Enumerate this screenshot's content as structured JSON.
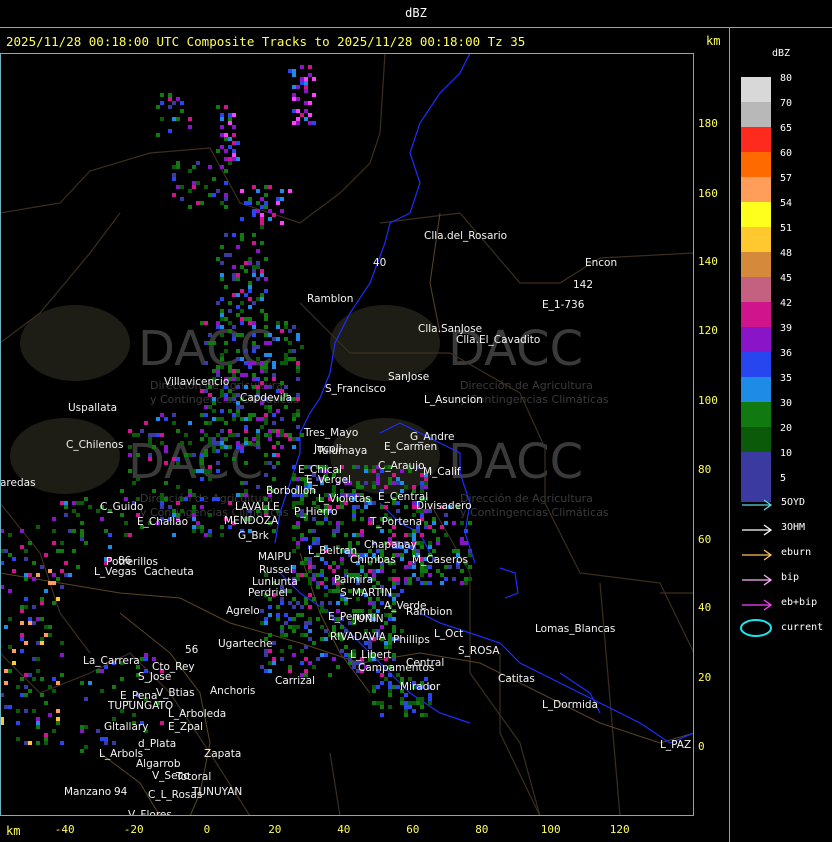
{
  "window": {
    "title": "dBZ"
  },
  "header": {
    "title": "2025/11/28 00:18:00 UTC Composite Tracks to 2025/11/28 00:18:00 Tz 35",
    "km_unit": "km"
  },
  "axes": {
    "x_unit": "km",
    "x_ticks": [
      "-40",
      "-20",
      "0",
      "20",
      "40",
      "60",
      "80",
      "100",
      "120"
    ],
    "y_ticks": [
      "180",
      "160",
      "140",
      "120",
      "100",
      "80",
      "60",
      "40",
      "20",
      "0"
    ]
  },
  "legend": {
    "title": "dBZ",
    "levels": [
      {
        "label": "80",
        "color": "#d8d8d8"
      },
      {
        "label": "70",
        "color": "#b8b8b8"
      },
      {
        "label": "65",
        "color": "#ff2a1e"
      },
      {
        "label": "60",
        "color": "#ff6a00"
      },
      {
        "label": "57",
        "color": "#ff9e5a"
      },
      {
        "label": "54",
        "color": "#ffff1e"
      },
      {
        "label": "51",
        "color": "#ffc82e"
      },
      {
        "label": "48",
        "color": "#d48a3a"
      },
      {
        "label": "45",
        "color": "#c46080"
      },
      {
        "label": "42",
        "color": "#d0148c"
      },
      {
        "label": "39",
        "color": "#8a14c8"
      },
      {
        "label": "36",
        "color": "#2846f0"
      },
      {
        "label": "35",
        "color": "#1e8ce6"
      },
      {
        "label": "30",
        "color": "#107a10"
      },
      {
        "label": "20",
        "color": "#0a5a0a"
      },
      {
        "label": "10",
        "color": "#3a3aa0"
      },
      {
        "label": "5",
        "color": "#3a3aa0"
      }
    ],
    "tracks": [
      {
        "label": "5OYD",
        "color": "#5ad8e6"
      },
      {
        "label": "3OHM",
        "color": "#ffffff"
      },
      {
        "label": "eburn",
        "color": "#ffc060"
      },
      {
        "label": "bip",
        "color": "#ffb0ff"
      },
      {
        "label": "eb+bip",
        "color": "#ff40ff"
      },
      {
        "label": "current",
        "color": "#18e6f0"
      }
    ]
  },
  "watermark": {
    "name": "DACC",
    "subtitle_1": "Dirección de Agricultura",
    "subtitle_2": "y Contingencias Climáticas"
  },
  "places": [
    {
      "name": "Clla.del_Rosario"
    },
    {
      "name": "Encon"
    },
    {
      "name": "142"
    },
    {
      "name": "E_1-736"
    },
    {
      "name": "Ramblon"
    },
    {
      "name": "Clla.SanJose"
    },
    {
      "name": "Clla.El_Cavadito"
    },
    {
      "name": "Villavicencio"
    },
    {
      "name": "Uspallata"
    },
    {
      "name": "Capdevila"
    },
    {
      "name": "S_Francisco"
    },
    {
      "name": "SanJose"
    },
    {
      "name": "L_Asuncion"
    },
    {
      "name": "Jocoli"
    },
    {
      "name": "C_Chilenos"
    },
    {
      "name": "Tres_Mayo"
    },
    {
      "name": "Tulumaya"
    },
    {
      "name": "G_Andre"
    },
    {
      "name": "E_Carmen"
    },
    {
      "name": "E_Chical"
    },
    {
      "name": "C_Araujo"
    },
    {
      "name": "E_Vergel"
    },
    {
      "name": "M_Calif"
    },
    {
      "name": "aredas"
    },
    {
      "name": "Borbollon"
    },
    {
      "name": "L_Violetas"
    },
    {
      "name": "E_Central"
    },
    {
      "name": "LAVALLE"
    },
    {
      "name": "P_Hierro"
    },
    {
      "name": "Divisadero"
    },
    {
      "name": "C_Guido"
    },
    {
      "name": "E_Challao"
    },
    {
      "name": "MENDOZA"
    },
    {
      "name": "T_Portena"
    },
    {
      "name": "G_Brk"
    },
    {
      "name": "Chapanay"
    },
    {
      "name": "L_Beltran"
    },
    {
      "name": "Potrerillos"
    },
    {
      "name": "MAIPU"
    },
    {
      "name": "Chimbas"
    },
    {
      "name": "M_Caseros"
    },
    {
      "name": "L_Vegas"
    },
    {
      "name": "Cacheuta"
    },
    {
      "name": "Russel"
    },
    {
      "name": "Palmira"
    },
    {
      "name": "Lunlunta"
    },
    {
      "name": "Perdriel"
    },
    {
      "name": "S_MARTIN"
    },
    {
      "name": "Agrelo"
    },
    {
      "name": "A_Verde"
    },
    {
      "name": "Rambion"
    },
    {
      "name": "E_Penon"
    },
    {
      "name": "JUNIN"
    },
    {
      "name": "Lomas_Blancas"
    },
    {
      "name": "Ugarteche"
    },
    {
      "name": "RIVADAVIA"
    },
    {
      "name": "L_Oct"
    },
    {
      "name": "Phillips"
    },
    {
      "name": "L_Libert"
    },
    {
      "name": "S_ROSA"
    },
    {
      "name": "La_Carrera"
    },
    {
      "name": "Cto_Rey"
    },
    {
      "name": "S_Jose"
    },
    {
      "name": "Carrizal"
    },
    {
      "name": "Campamentos"
    },
    {
      "name": "Catitas"
    },
    {
      "name": "Central"
    },
    {
      "name": "Mirador"
    },
    {
      "name": "E_Pena"
    },
    {
      "name": "V_Btias"
    },
    {
      "name": "TUPUNGATO"
    },
    {
      "name": "Anchoris"
    },
    {
      "name": "L_Dormida"
    },
    {
      "name": "L_Arboleda"
    },
    {
      "name": "Gltallary"
    },
    {
      "name": "E_Zpal"
    },
    {
      "name": "d_Plata"
    },
    {
      "name": "L_Arbols"
    },
    {
      "name": "Zapata"
    },
    {
      "name": "L_PAZ"
    },
    {
      "name": "Algarrob"
    },
    {
      "name": "V_Seco"
    },
    {
      "name": "Totoral"
    },
    {
      "name": "TUNUYAN"
    },
    {
      "name": "Manzano"
    },
    {
      "name": "C_L_Rosas"
    },
    {
      "name": "V_Flores"
    },
    {
      "name": "40"
    },
    {
      "name": "86"
    },
    {
      "name": "56"
    },
    {
      "name": "94"
    }
  ]
}
